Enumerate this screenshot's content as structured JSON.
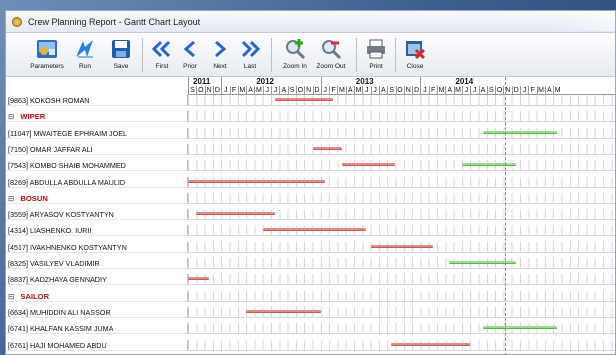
{
  "window": {
    "title": "Crew Planning Report - Gantt Chart Layout"
  },
  "toolbar": {
    "parameters": "Parameters",
    "run": "Run",
    "save": "Save",
    "first": "First",
    "prior": "Prior",
    "next": "Next",
    "last": "Last",
    "zoom_in": "Zoom In",
    "zoom_out": "Zoom Out",
    "print": "Print",
    "close": "Close"
  },
  "timeline": {
    "years": [
      "2011",
      "2012",
      "2013",
      "2014"
    ],
    "months": [
      "S",
      "O",
      "N",
      "D",
      "J",
      "F",
      "M",
      "A",
      "M",
      "J",
      "J",
      "A",
      "S",
      "O",
      "N",
      "D",
      "J",
      "F",
      "M",
      "A",
      "M",
      "J",
      "J",
      "A",
      "S",
      "O",
      "N",
      "D",
      "J",
      "F",
      "M",
      "A",
      "M",
      "J",
      "J",
      "A",
      "S",
      "O",
      "N",
      "D",
      "J",
      "F",
      "M",
      "A",
      "M"
    ]
  },
  "rows": [
    {
      "type": "crew",
      "label": "[9863] KOKOSH ROMAN",
      "bar": {
        "start": 10.5,
        "end": 17.5,
        "color": "red"
      }
    },
    {
      "type": "group",
      "label": "WIPER"
    },
    {
      "type": "crew",
      "label": "[11047] MWAITEGE EPHRAIM JOEL",
      "bar": {
        "start": 35.5,
        "end": 44.5,
        "color": "green"
      }
    },
    {
      "type": "crew",
      "label": "[7150] OMAR JAFFAR ALI",
      "bar": {
        "start": 15.0,
        "end": 18.5,
        "color": "red"
      }
    },
    {
      "type": "crew",
      "label": "[7543] KOMBO SHAIB MOHAMMED",
      "bar": {
        "start": 18.5,
        "end": 25.0,
        "color": "red"
      },
      "bar2": {
        "start": 33.0,
        "end": 39.5,
        "color": "green"
      }
    },
    {
      "type": "crew",
      "label": "[8269] ABDULLA ABDULLA MAULID",
      "bar": {
        "start": 0.0,
        "end": 16.5,
        "color": "red"
      }
    },
    {
      "type": "group",
      "label": "BOSUN"
    },
    {
      "type": "crew",
      "label": "[3559] ARYASOV KOSTYANTYN",
      "bar": {
        "start": 1.0,
        "end": 10.5,
        "color": "red"
      }
    },
    {
      "type": "crew",
      "label": "[4314] LIASHENKO. IURII",
      "bar": {
        "start": 9.0,
        "end": 21.5,
        "color": "red"
      }
    },
    {
      "type": "crew",
      "label": "[4517] IVAKHNENKO KOSTYANTYN",
      "bar": {
        "start": 22.0,
        "end": 29.5,
        "color": "red"
      }
    },
    {
      "type": "crew",
      "label": "[8325] VASILYEV VLADIMIR",
      "bar": {
        "start": 31.5,
        "end": 39.5,
        "color": "green"
      }
    },
    {
      "type": "crew",
      "label": "[8837] KADZHAYA GENNADIY",
      "bar": {
        "start": 0.0,
        "end": 2.5,
        "color": "red"
      }
    },
    {
      "type": "group",
      "label": "SAILOR"
    },
    {
      "type": "crew",
      "label": "[6634] MUHIDDIN ALI NASSOR",
      "bar": {
        "start": 7.0,
        "end": 16.0,
        "color": "red"
      }
    },
    {
      "type": "crew",
      "label": "[6741] KHALFAN KASSIM JUMA",
      "bar": {
        "start": 35.5,
        "end": 44.5,
        "color": "green"
      }
    },
    {
      "type": "crew",
      "label": "[6761] HAJI MOHAMED ABDU",
      "bar": {
        "start": 24.5,
        "end": 34.0,
        "color": "red"
      }
    }
  ]
}
